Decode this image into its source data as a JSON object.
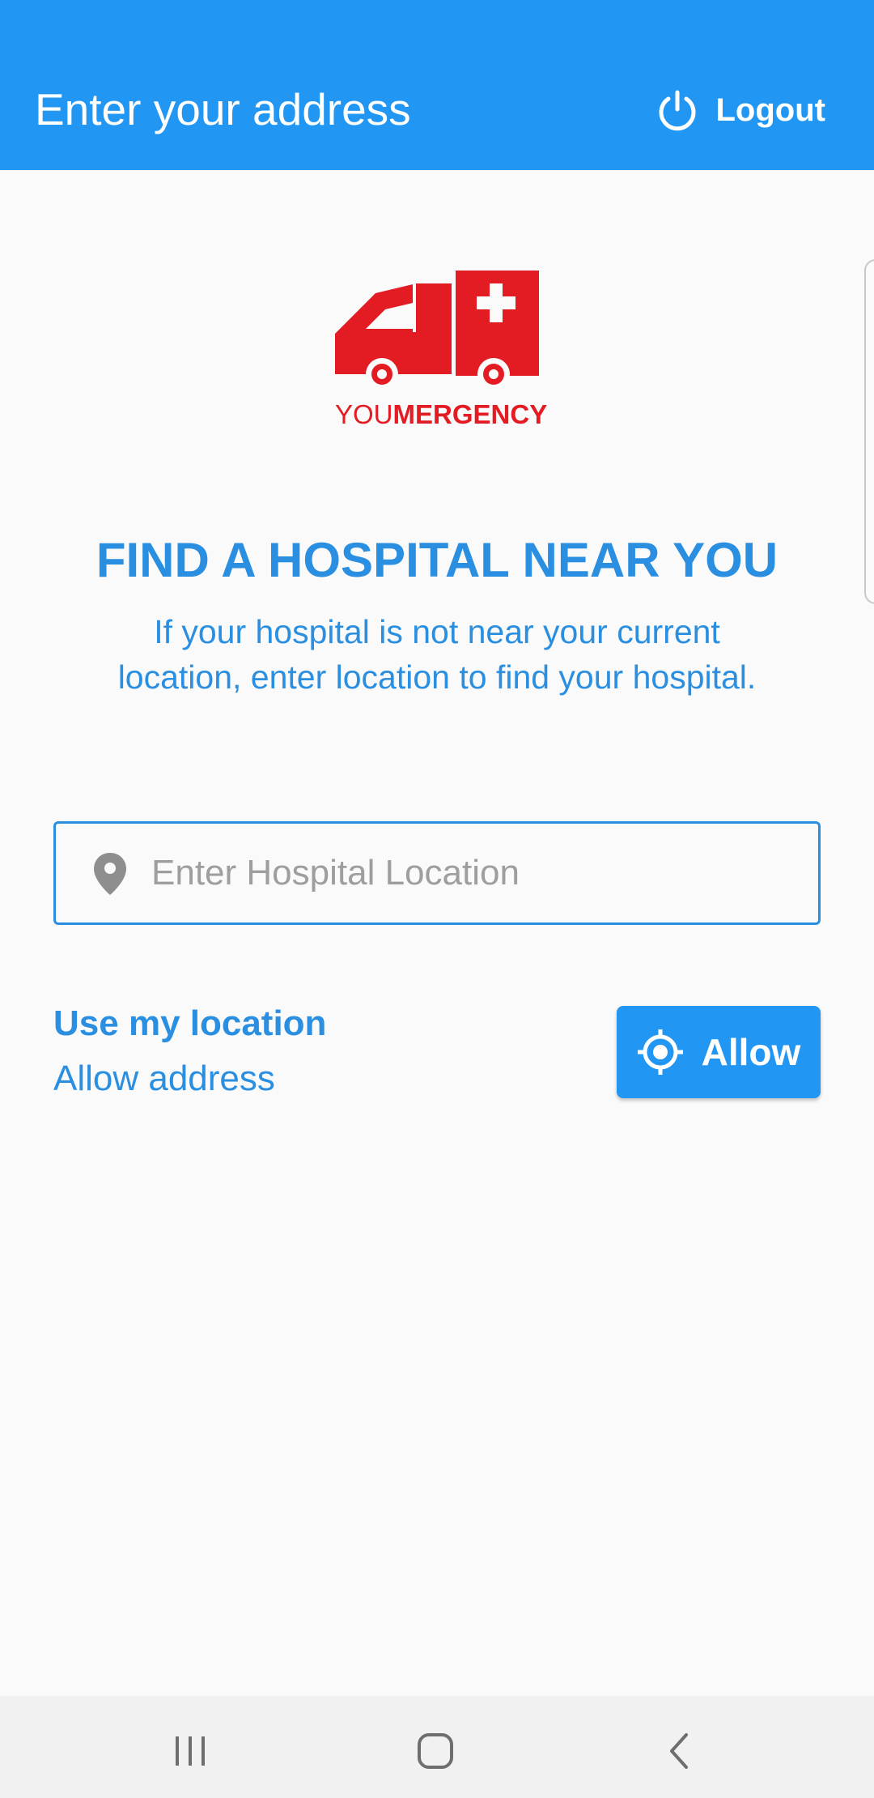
{
  "appbar": {
    "title": "Enter your address",
    "logout_label": "Logout",
    "background_color": "#2196f3"
  },
  "logo": {
    "text_light": "YOU",
    "text_bold": "MERGENCY",
    "icon": "ambulance-icon",
    "color": "#e31b23"
  },
  "main": {
    "headline": "FIND A HOSPITAL NEAR YOU",
    "subtext": "If your hospital is not near your current location, enter location to find your hospital.",
    "accent_color": "#2a8fe0"
  },
  "search": {
    "placeholder": "Enter Hospital Location",
    "value": "",
    "icon": "location-pin-icon"
  },
  "location": {
    "title": "Use my location",
    "subtitle": "Allow address",
    "allow_label": "Allow",
    "allow_icon": "gps-crosshair-icon"
  },
  "navbar": {
    "recent_icon": "recent-apps-icon",
    "home_icon": "home-icon",
    "back_icon": "back-icon"
  }
}
